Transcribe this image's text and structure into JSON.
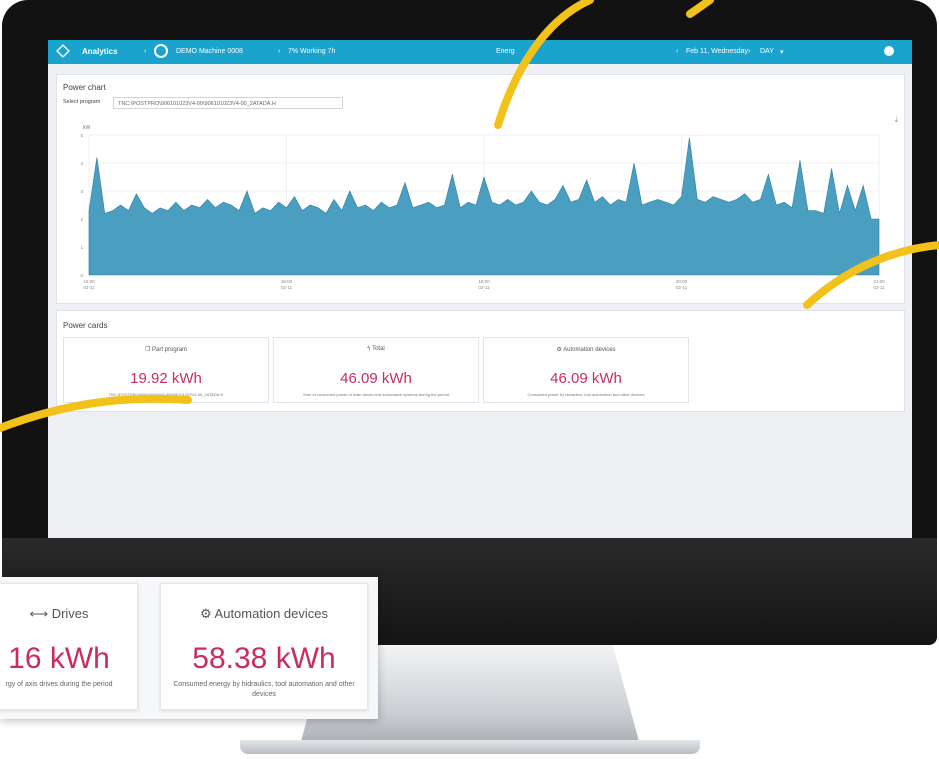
{
  "topbar": {
    "app_title": "Analytics",
    "machine": "DEMO Machine 0008",
    "status": "7% Working 7h",
    "center": "Energ",
    "date": "Feb 11, Wednesday",
    "range": "DAY"
  },
  "power_chart": {
    "title": "Power chart",
    "select_label": "Select program",
    "select_value": "TNC:\\POSTPRO\\906101023V4-00\\906101023V4-00_2ATADA.H"
  },
  "chart_data": {
    "type": "area",
    "ylabel": "kW",
    "ylim": [
      0,
      5
    ],
    "y_ticks": [
      "0",
      "1",
      "2",
      "3",
      "4",
      "5"
    ],
    "x_ticks": [
      "15:00\n02-11",
      "16:00\n02-11",
      "18:00\n02-11",
      "20:00\n02-11",
      "21:00\n02-11"
    ],
    "series": [
      {
        "values": [
          2.3,
          4.2,
          2.2,
          2.3,
          2.5,
          2.3,
          2.9,
          2.4,
          2.2,
          2.4,
          2.3,
          2.6,
          2.3,
          2.5,
          2.4,
          2.7,
          2.4,
          2.6,
          2.5,
          2.3,
          3.0,
          2.2,
          2.4,
          2.3,
          2.6,
          2.4,
          2.8,
          2.3,
          2.5,
          2.4,
          2.2,
          2.7,
          2.3,
          3.0,
          2.4,
          2.5,
          2.3,
          2.6,
          2.4,
          2.5,
          3.3,
          2.4,
          2.5,
          2.6,
          2.4,
          2.5,
          3.6,
          2.4,
          2.6,
          2.5,
          3.5,
          2.6,
          2.5,
          2.7,
          2.5,
          2.6,
          3.0,
          2.6,
          2.5,
          2.7,
          3.2,
          2.6,
          2.7,
          3.4,
          2.6,
          2.8,
          2.5,
          2.7,
          2.6,
          4.0,
          2.5,
          2.6,
          2.7,
          2.6,
          2.5,
          2.8,
          4.9,
          2.7,
          2.6,
          2.8,
          2.7,
          2.6,
          2.7,
          2.9,
          2.6,
          2.7,
          3.6,
          2.5,
          2.6,
          2.4,
          4.1,
          2.3,
          2.3,
          2.2,
          3.8,
          2.2,
          3.2,
          2.3,
          3.2,
          2.0,
          2.0
        ]
      }
    ]
  },
  "power_cards": {
    "title": "Power cards",
    "cards": [
      {
        "icon": "cube-icon",
        "title": "Part program",
        "value": "19.92 kWh",
        "desc": "TNC:\\POSTPRO\\906101023V4-00\\906101023V4-00_2ATADA.H"
      },
      {
        "icon": "lightning-icon",
        "title": "Total",
        "value": "46.09 kWh",
        "desc": "Sum of consumed power of main drives and automation systems during the period"
      },
      {
        "icon": "automation-icon",
        "title": "Automation devices",
        "value": "46.09 kWh",
        "desc": "Consumed power by hidraulics, tool automation and other devices"
      }
    ]
  },
  "popup_cards": [
    {
      "icon": "drives-icon",
      "title": "Drives",
      "value": "16 kWh",
      "desc": "rgy of axis drives during the period"
    },
    {
      "icon": "automation-icon",
      "title": "Automation devices",
      "value": "58.38 kWh",
      "desc": "Consumed energy by hidraulics, tool automation and other devices"
    }
  ],
  "colors": {
    "accent": "#1aa3cc",
    "area_fill": "#4a9ebf",
    "value": "#c62f5d",
    "swoosh": "#f2c11a"
  }
}
